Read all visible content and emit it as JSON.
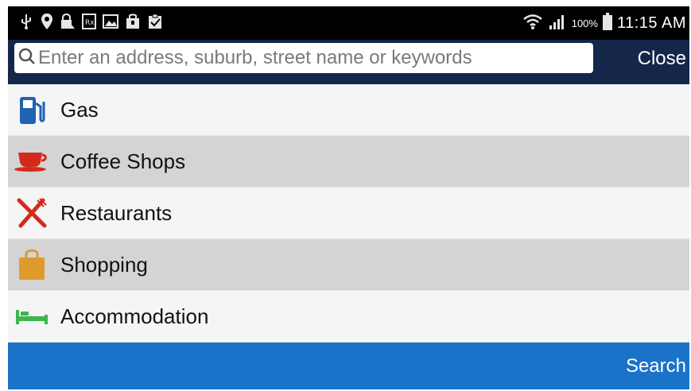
{
  "status_bar": {
    "notification_icons": [
      "usb-icon",
      "location-pin-icon",
      "lock-icon",
      "rx-icon",
      "image-icon",
      "shopping-bag-icon",
      "clipboard-check-icon"
    ],
    "wifi": "wifi-icon",
    "signal": "signal-icon",
    "battery_percent": "100%",
    "battery": "battery-icon",
    "time": "11:15 AM"
  },
  "search": {
    "placeholder": "Enter an address, suburb, street name or keywords",
    "value": "",
    "close_label": "Close"
  },
  "categories": [
    {
      "label": "Gas",
      "icon": "gas-pump-icon",
      "color": "#1f63b3"
    },
    {
      "label": "Coffee Shops",
      "icon": "coffee-cup-icon",
      "color": "#d42a1c"
    },
    {
      "label": "Restaurants",
      "icon": "fork-knife-icon",
      "color": "#d42a1c"
    },
    {
      "label": "Shopping",
      "icon": "shopping-bag-icon",
      "color": "#e09a2c"
    },
    {
      "label": "Accommodation",
      "icon": "bed-icon",
      "color": "#3cb54a"
    }
  ],
  "footer": {
    "search_label": "Search"
  },
  "colors": {
    "header_bg": "#14264a",
    "bottom_bar_bg": "#1a73c9",
    "row_light": "#f5f5f5",
    "row_dark": "#d4d4d4"
  }
}
